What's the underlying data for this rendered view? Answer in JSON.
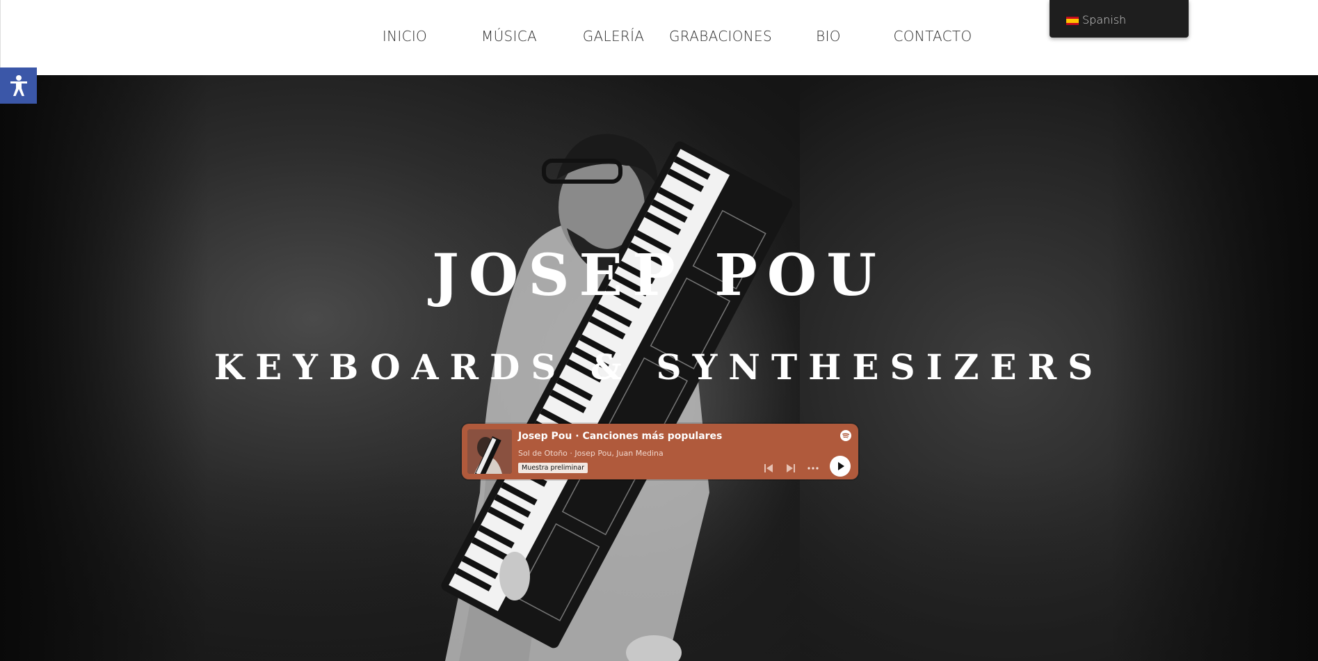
{
  "nav": {
    "items": [
      {
        "label": "INICIO"
      },
      {
        "label": "MÚSICA"
      },
      {
        "label": "GALERÍA"
      },
      {
        "label": "GRABACIONES"
      },
      {
        "label": "BIO"
      },
      {
        "label": "CONTACTO"
      }
    ]
  },
  "language": {
    "label": "Spanish",
    "flag_icon": "spain-flag-icon"
  },
  "accessibility": {
    "icon": "accessibility-icon",
    "color": "#3b57a8"
  },
  "hero": {
    "title": "JOSEP POU",
    "subtitle": "KEYBOARDS & SYNTHESIZERS"
  },
  "player": {
    "title": "Josep Pou · Canciones más populares",
    "track": "Sol de Otoño",
    "artists": "Josep Pou, Juan Medina",
    "badge": "Muestra preliminar",
    "accent": "#b05a3c"
  }
}
